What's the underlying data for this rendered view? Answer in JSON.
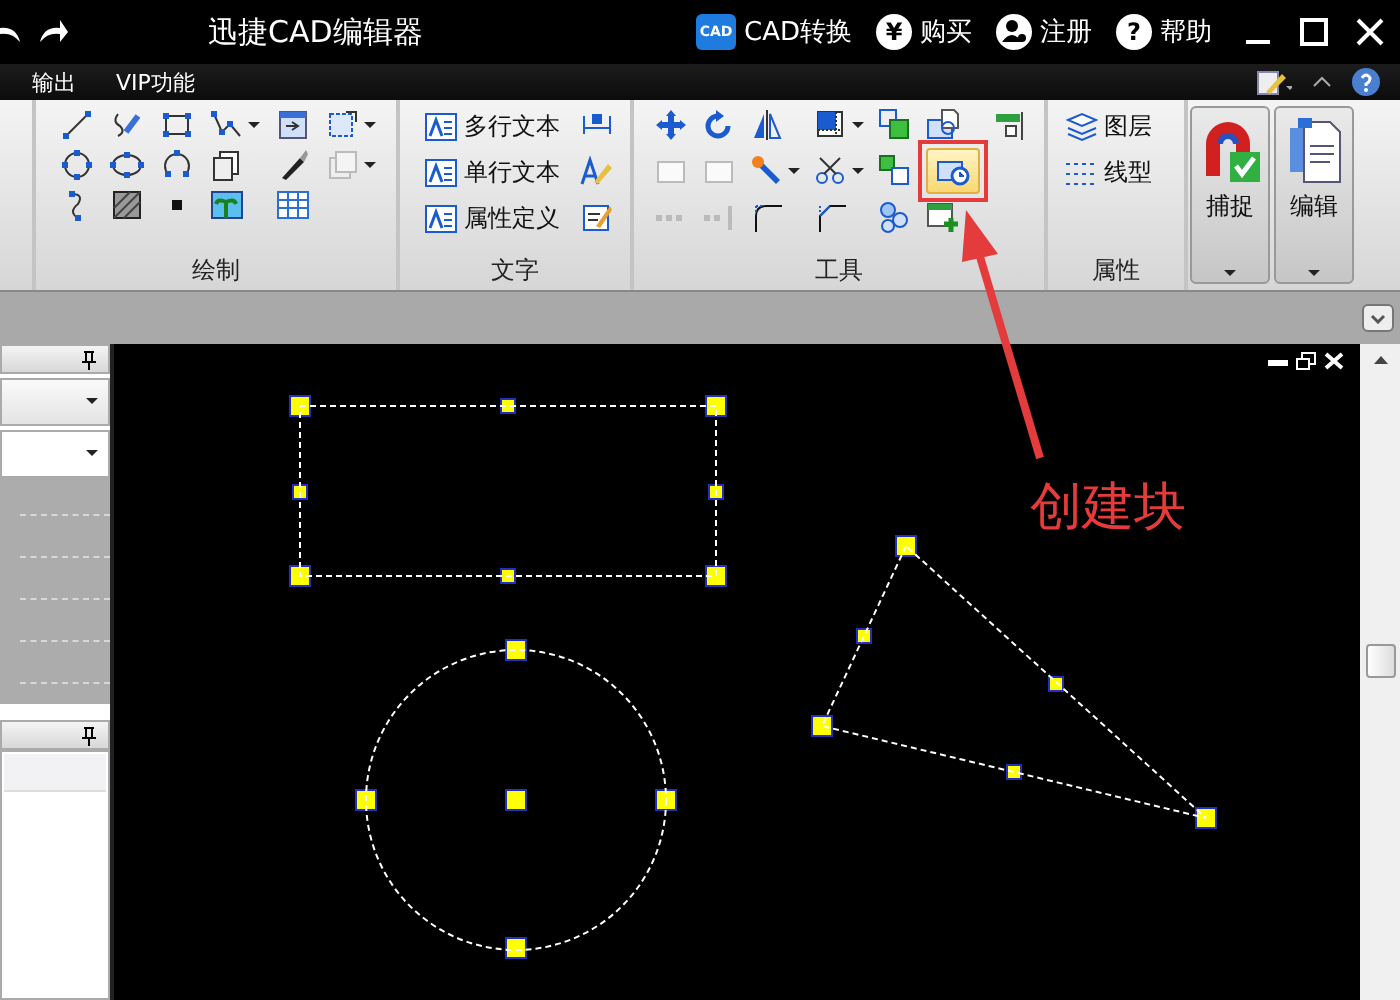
{
  "window": {
    "title": "迅捷CAD编辑器"
  },
  "title_actions": [
    {
      "label": "CAD转换",
      "kind": "convert",
      "badge": "CAD"
    },
    {
      "label": "购买",
      "kind": "buy",
      "badge": "¥"
    },
    {
      "label": "注册",
      "kind": "register"
    },
    {
      "label": "帮助",
      "kind": "help",
      "badge": "?"
    }
  ],
  "menu": [
    "输出",
    "VIP功能"
  ],
  "ribbon": {
    "groups": [
      {
        "label": "绘制",
        "kind": "draw"
      },
      {
        "label": "文字",
        "kind": "text",
        "buttons": [
          "多行文本",
          "单行文本",
          "属性定义"
        ]
      },
      {
        "label": "工具",
        "kind": "tools"
      },
      {
        "label": "属性",
        "kind": "props",
        "buttons": [
          "图层",
          "线型"
        ]
      }
    ],
    "large_buttons": [
      {
        "label": "捕捉",
        "kind": "snap"
      },
      {
        "label": "编辑",
        "kind": "edit"
      }
    ]
  },
  "annotation": {
    "text": "创建块"
  }
}
